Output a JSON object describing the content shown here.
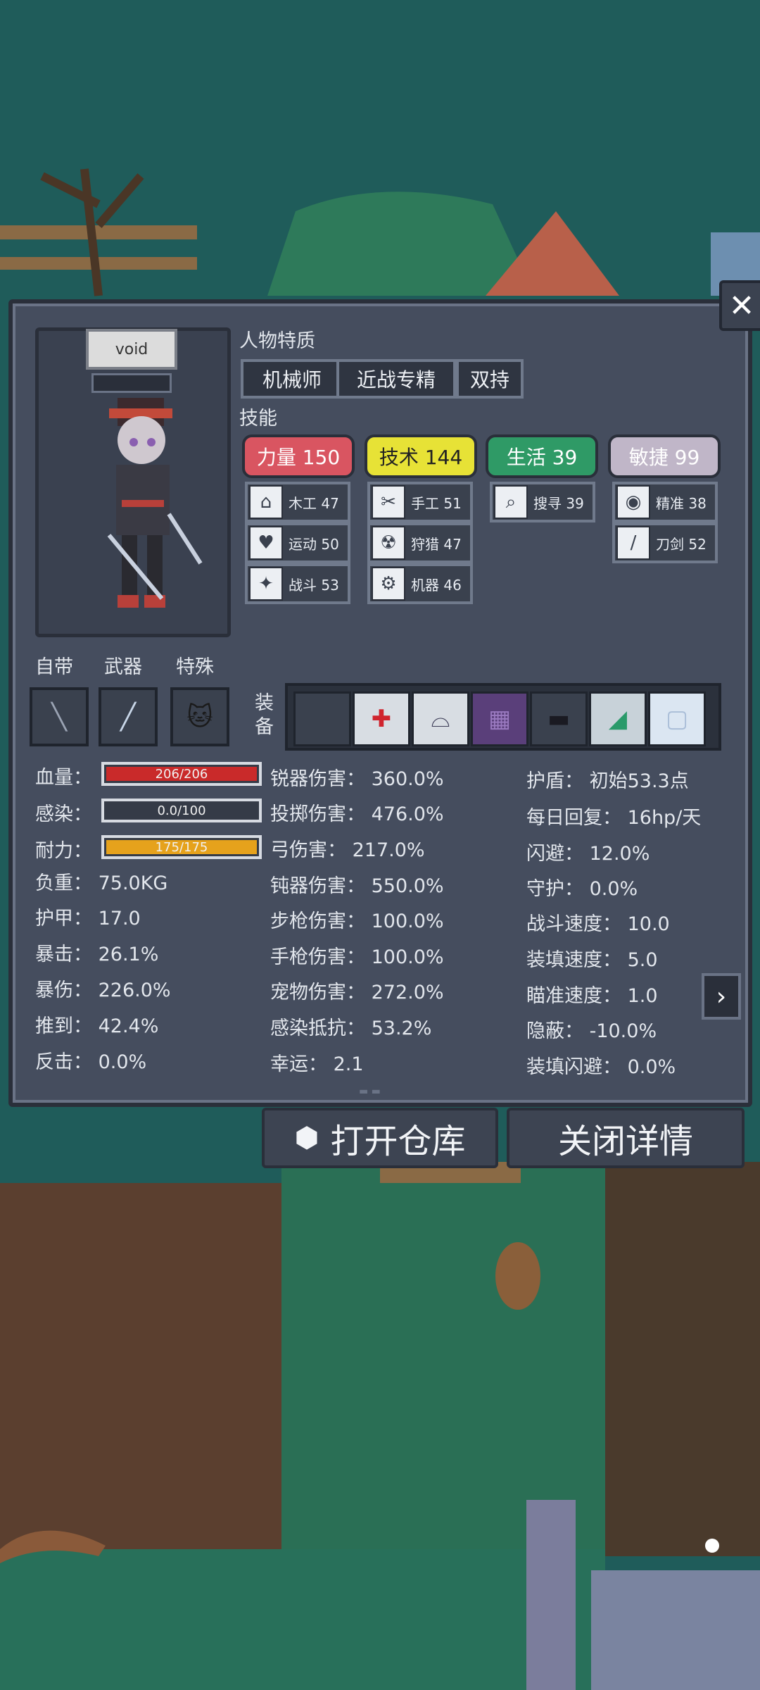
{
  "character": {
    "name": "void"
  },
  "traits_title": "人物特质",
  "traits": [
    "机械师",
    "近战专精",
    "双持"
  ],
  "skills_title": "技能",
  "attributes": [
    {
      "label": "力量 150",
      "color": "#d95561"
    },
    {
      "label": "技术 144",
      "color": "#e7e236"
    },
    {
      "label": "生活 39",
      "color": "#2f9a66"
    },
    {
      "label": "敏捷 99",
      "color": "#c0b6c8"
    }
  ],
  "skills": {
    "mugong": {
      "label": "木工 47",
      "icon": "house-icon"
    },
    "shougong": {
      "label": "手工 51",
      "icon": "scissors-icon"
    },
    "soushun": {
      "label": "搜寻 39",
      "icon": "magnifier-icon"
    },
    "jingzhun": {
      "label": "精准 38",
      "icon": "eye-icon"
    },
    "yundong": {
      "label": "运动 50",
      "icon": "heart-icon"
    },
    "shoulie": {
      "label": "狩猎 47",
      "icon": "radiation-icon"
    },
    "daojian": {
      "label": "刀剑 52",
      "icon": "sword-icon"
    },
    "zhandou": {
      "label": "战斗 53",
      "icon": "fist-icon"
    },
    "jiqi": {
      "label": "机器 46",
      "icon": "gear-icon"
    }
  },
  "slots": {
    "builtin": "自带",
    "weapon": "武器",
    "special": "特殊",
    "equip": "装备"
  },
  "bars": {
    "hp": {
      "label": "血量：",
      "text": "206/206",
      "fraction": 1.0
    },
    "infection": {
      "label": "感染：",
      "text": "0.0/100",
      "fraction": 0.0
    },
    "stamina": {
      "label": "耐力：",
      "text": "175/175",
      "fraction": 1.0
    }
  },
  "stats_left": [
    "负重：  75.0KG",
    "护甲：  17.0",
    "暴击：  26.1%",
    "暴伤：  226.0%",
    "推到：  42.4%",
    "反击：  0.0%"
  ],
  "stats_mid": [
    "锐器伤害：  360.0%",
    "投掷伤害：  476.0%",
    "弓伤害：  217.0%",
    "钝器伤害：  550.0%",
    "步枪伤害：  100.0%",
    "手枪伤害：  100.0%",
    "宠物伤害：  272.0%",
    "感染抵抗：  53.2%",
    "幸运：  2.1"
  ],
  "stats_right": [
    "护盾：  初始53.3点",
    "每日回复：  16hp/天",
    "闪避：  12.0%",
    "守护：  0.0%",
    "战斗速度：  10.0",
    "装填速度：  5.0",
    "瞄准速度：  1.0",
    "隐蔽：  -10.0%",
    "装填闪避：  0.0%"
  ],
  "buttons": {
    "open_storage": "打开仓库",
    "close_details": "关闭详情",
    "close_icon": "✕",
    "next_icon": "›"
  }
}
